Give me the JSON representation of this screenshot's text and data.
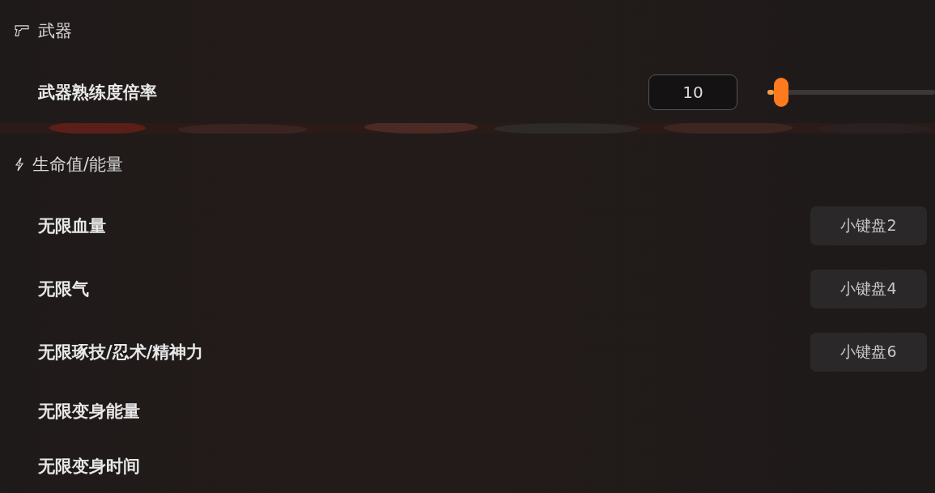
{
  "sections": [
    {
      "title": "武器",
      "items": [
        {
          "kind": "slider",
          "label": "武器熟练度倍率",
          "value": "10",
          "level": 0.08
        }
      ]
    },
    {
      "title": "生命值/能量",
      "items": [
        {
          "kind": "hotkey",
          "label": "无限血量",
          "hotkey": "小键盘2"
        },
        {
          "kind": "hotkey",
          "label": "无限气",
          "hotkey": "小键盘4"
        },
        {
          "kind": "hotkey",
          "label": "无限琢技/忍术/精神力",
          "hotkey": "小键盘6"
        },
        {
          "kind": "plain",
          "label": "无限变身能量"
        },
        {
          "kind": "plain",
          "label": "无限变身时间"
        }
      ]
    }
  ]
}
